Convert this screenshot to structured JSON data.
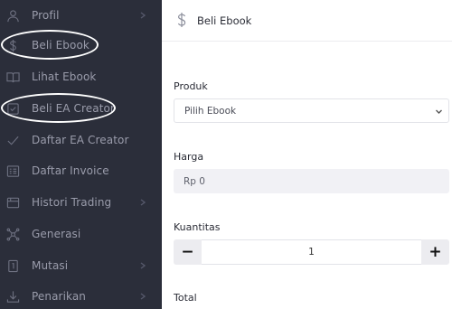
{
  "sidebar": {
    "items": [
      {
        "label": "Profil",
        "icon": "user-icon",
        "has_chevron": true
      },
      {
        "label": "Beli Ebook",
        "icon": "dollar-icon",
        "has_chevron": false
      },
      {
        "label": "Lihat Ebook",
        "icon": "book-icon",
        "has_chevron": false
      },
      {
        "label": "Beli EA Creator",
        "icon": "check-square-icon",
        "has_chevron": false
      },
      {
        "label": "Daftar EA Creator",
        "icon": "check-icon",
        "has_chevron": false
      },
      {
        "label": "Daftar Invoice",
        "icon": "invoice-icon",
        "has_chevron": false
      },
      {
        "label": "Histori Trading",
        "icon": "history-icon",
        "has_chevron": true
      },
      {
        "label": "Generasi",
        "icon": "network-icon",
        "has_chevron": false
      },
      {
        "label": "Mutasi",
        "icon": "mutasi-icon",
        "has_chevron": true
      },
      {
        "label": "Penarikan",
        "icon": "download-icon",
        "has_chevron": true
      }
    ]
  },
  "header": {
    "title": "Beli Ebook",
    "icon": "dollar-icon"
  },
  "form": {
    "produk_label": "Produk",
    "produk_value": "Pilih Ebook",
    "harga_label": "Harga",
    "harga_value": "Rp 0",
    "kuantitas_label": "Kuantitas",
    "kuantitas_value": "1",
    "minus_label": "−",
    "plus_label": "+",
    "total_label": "Total"
  },
  "colors": {
    "sidebar_bg": "#2b2e3a",
    "sidebar_text": "#9a9cab",
    "annotation": "#ffffff"
  }
}
